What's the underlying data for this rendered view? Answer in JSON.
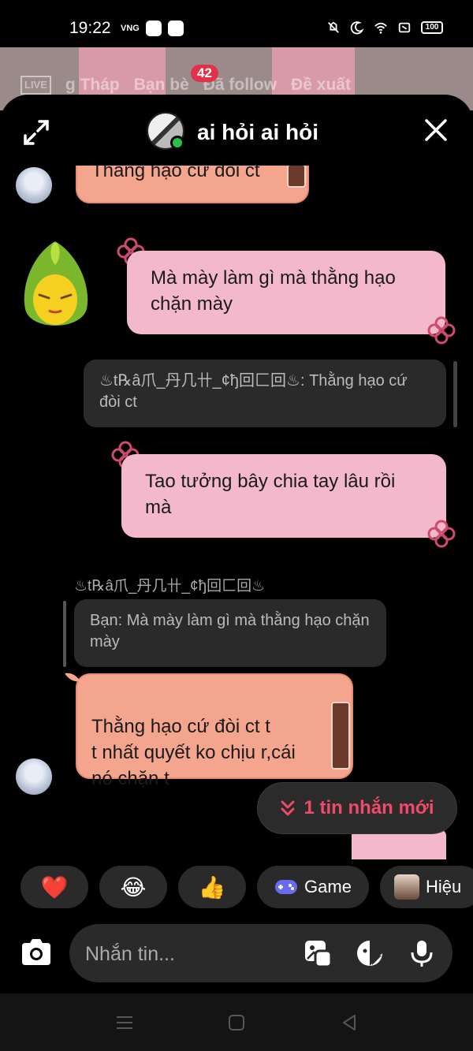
{
  "status_bar": {
    "time": "19:22",
    "carrier_badge": "VNG",
    "battery": "100"
  },
  "background_tabs": [
    "LIVE",
    "g Tháp",
    "Bạn bè",
    "Đã follow",
    "Đề xuất"
  ],
  "background_badge": "42",
  "header": {
    "title": "ai hỏi ai hỏi"
  },
  "messages": {
    "top_partial": "Thằng hạo cứ đòi ct",
    "outgoing_1": "Mà mày làm gì mà thằng hạo chặn mày",
    "reply_quote_1": "♨t℞â爪_丹几卄_¢ђ回匚回♨: Thằng hạo cứ đòi ct",
    "outgoing_2": "Tao tưởng bây chia tay lâu rồi mà",
    "sender_name": "♨t℞â爪_丹几卄_¢ђ回匚回♨",
    "reply_quote_2": "Bạn: Mà mày làm gì mà thằng hạo chặn mày",
    "incoming_1": "Thằng hạo cứ đòi ct t\nt nhất quyết ko chịu r,cái nó chặn t"
  },
  "new_messages_pill": "1 tin nhắn mới",
  "quick_replies": [
    {
      "label": "❤️",
      "icon": "heart-icon"
    },
    {
      "label": "😂",
      "icon": "laugh-icon"
    },
    {
      "label": "👍",
      "icon": "thumbs-up-icon"
    },
    {
      "label": "Game",
      "icon": "gamepad-icon"
    },
    {
      "label": "Hiệu",
      "icon": "effect-icon"
    }
  ],
  "composer": {
    "placeholder": "Nhắn tin..."
  },
  "colors": {
    "accent": "#f04a6a",
    "salmon": "#f4a58d",
    "pink": "#f3b8cb",
    "online": "#27c24c"
  }
}
